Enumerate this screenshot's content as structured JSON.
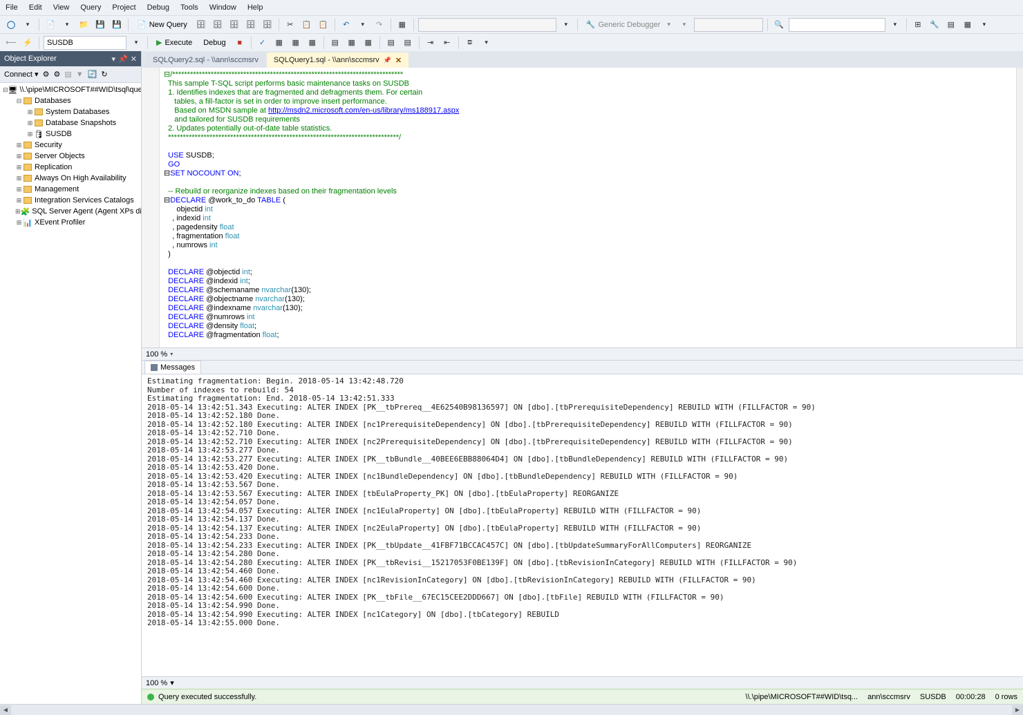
{
  "menu": [
    "File",
    "Edit",
    "View",
    "Query",
    "Project",
    "Debug",
    "Tools",
    "Window",
    "Help"
  ],
  "toolbar1": {
    "new_query": "New Query",
    "debugger_label": "Generic Debugger"
  },
  "toolbar2": {
    "db_combo": "SUSDB",
    "execute": "Execute",
    "debug": "Debug"
  },
  "object_explorer": {
    "title": "Object Explorer",
    "connect": "Connect",
    "root": "\\\\.\\pipe\\MICROSOFT##WID\\tsql\\query",
    "nodes": [
      {
        "label": "Databases",
        "depth": 1,
        "expanded": true,
        "icon": "folder"
      },
      {
        "label": "System Databases",
        "depth": 2,
        "expanded": false,
        "icon": "folder"
      },
      {
        "label": "Database Snapshots",
        "depth": 2,
        "expanded": false,
        "icon": "folder"
      },
      {
        "label": "SUSDB",
        "depth": 2,
        "expanded": false,
        "icon": "db"
      },
      {
        "label": "Security",
        "depth": 1,
        "expanded": false,
        "icon": "folder"
      },
      {
        "label": "Server Objects",
        "depth": 1,
        "expanded": false,
        "icon": "folder"
      },
      {
        "label": "Replication",
        "depth": 1,
        "expanded": false,
        "icon": "folder"
      },
      {
        "label": "Always On High Availability",
        "depth": 1,
        "expanded": false,
        "icon": "folder"
      },
      {
        "label": "Management",
        "depth": 1,
        "expanded": false,
        "icon": "folder"
      },
      {
        "label": "Integration Services Catalogs",
        "depth": 1,
        "expanded": false,
        "icon": "folder"
      },
      {
        "label": "SQL Server Agent (Agent XPs disabl",
        "depth": 1,
        "expanded": false,
        "icon": "agent"
      },
      {
        "label": "XEvent Profiler",
        "depth": 1,
        "expanded": false,
        "icon": "xe"
      }
    ]
  },
  "tabs": [
    {
      "label": "SQLQuery2.sql - \\\\ann\\sccmsrv",
      "active": false
    },
    {
      "label": "SQLQuery1.sql - \\\\ann\\sccmsrv",
      "active": true
    }
  ],
  "code_lines": [
    {
      "t": "⊟/******************************************************************************",
      "cls": "c-star"
    },
    {
      "t": "  This sample T-SQL script performs basic maintenance tasks on SUSDB",
      "cls": "c-comment"
    },
    {
      "t": "  1. Identifies indexes that are fragmented and defragments them. For certain",
      "cls": "c-comment"
    },
    {
      "t": "     tables, a fill-factor is set in order to improve insert performance.",
      "cls": "c-comment"
    },
    {
      "t": "     Based on MSDN sample at ",
      "cls": "c-comment",
      "link": "http://msdn2.microsoft.com/en-us/library/ms188917.aspx"
    },
    {
      "t": "     and tailored for SUSDB requirements",
      "cls": "c-comment"
    },
    {
      "t": "  2. Updates potentially out-of-date table statistics.",
      "cls": "c-comment"
    },
    {
      "t": "  ******************************************************************************/",
      "cls": "c-star"
    },
    {
      "t": "",
      "cls": ""
    },
    {
      "t": "  USE SUSDB;",
      "cls": "",
      "hl": [
        [
          "USE",
          "c-kw"
        ]
      ]
    },
    {
      "t": "  GO",
      "cls": "c-kw"
    },
    {
      "t": "⊟SET NOCOUNT ON;",
      "cls": "",
      "hl": [
        [
          "SET",
          "c-kw"
        ],
        [
          "NOCOUNT",
          "c-kw"
        ],
        [
          "ON",
          "c-kw"
        ]
      ]
    },
    {
      "t": "",
      "cls": ""
    },
    {
      "t": "  -- Rebuild or reorganize indexes based on their fragmentation levels",
      "cls": "c-comment"
    },
    {
      "t": "⊟DECLARE @work_to_do TABLE (",
      "cls": "",
      "hl": [
        [
          "DECLARE",
          "c-kw"
        ],
        [
          "TABLE",
          "c-kw"
        ]
      ]
    },
    {
      "t": "      objectid int",
      "cls": "",
      "hl": [
        [
          "int",
          "c-dtype"
        ]
      ]
    },
    {
      "t": "    , indexid int",
      "cls": "",
      "hl": [
        [
          "int",
          "c-dtype"
        ]
      ]
    },
    {
      "t": "    , pagedensity float",
      "cls": "",
      "hl": [
        [
          "float",
          "c-dtype"
        ]
      ]
    },
    {
      "t": "    , fragmentation float",
      "cls": "",
      "hl": [
        [
          "float",
          "c-dtype"
        ]
      ]
    },
    {
      "t": "    , numrows int",
      "cls": "",
      "hl": [
        [
          "int",
          "c-dtype"
        ]
      ]
    },
    {
      "t": "  )",
      "cls": ""
    },
    {
      "t": "",
      "cls": ""
    },
    {
      "t": "  DECLARE @objectid int;",
      "cls": "",
      "hl": [
        [
          "DECLARE",
          "c-kw"
        ],
        [
          "int",
          "c-dtype"
        ]
      ]
    },
    {
      "t": "  DECLARE @indexid int;",
      "cls": "",
      "hl": [
        [
          "DECLARE",
          "c-kw"
        ],
        [
          "int",
          "c-dtype"
        ]
      ]
    },
    {
      "t": "  DECLARE @schemaname nvarchar(130);",
      "cls": "",
      "hl": [
        [
          "DECLARE",
          "c-kw"
        ],
        [
          "nvarchar",
          "c-dtype"
        ]
      ]
    },
    {
      "t": "  DECLARE @objectname nvarchar(130);",
      "cls": "",
      "hl": [
        [
          "DECLARE",
          "c-kw"
        ],
        [
          "nvarchar",
          "c-dtype"
        ]
      ]
    },
    {
      "t": "  DECLARE @indexname nvarchar(130);",
      "cls": "",
      "hl": [
        [
          "DECLARE",
          "c-kw"
        ],
        [
          "nvarchar",
          "c-dtype"
        ]
      ]
    },
    {
      "t": "  DECLARE @numrows int",
      "cls": "",
      "hl": [
        [
          "DECLARE",
          "c-kw"
        ],
        [
          "int",
          "c-dtype"
        ]
      ]
    },
    {
      "t": "  DECLARE @density float;",
      "cls": "",
      "hl": [
        [
          "DECLARE",
          "c-kw"
        ],
        [
          "float",
          "c-dtype"
        ]
      ]
    },
    {
      "t": "  DECLARE @fragmentation float;",
      "cls": "",
      "hl": [
        [
          "DECLARE",
          "c-kw"
        ],
        [
          "float",
          "c-dtype"
        ]
      ]
    }
  ],
  "zoom": "100 %",
  "msg_tab": "Messages",
  "msg_lines": [
    "Estimating fragmentation: Begin. 2018-05-14 13:42:48.720",
    "Number of indexes to rebuild: 54",
    "Estimating fragmentation: End. 2018-05-14 13:42:51.333",
    "2018-05-14 13:42:51.343 Executing: ALTER INDEX [PK__tbPrereq__4E62540B98136597] ON [dbo].[tbPrerequisiteDependency] REBUILD WITH (FILLFACTOR = 90)",
    "2018-05-14 13:42:52.180 Done.",
    "2018-05-14 13:42:52.180 Executing: ALTER INDEX [nc1PrerequisiteDependency] ON [dbo].[tbPrerequisiteDependency] REBUILD WITH (FILLFACTOR = 90)",
    "2018-05-14 13:42:52.710 Done.",
    "2018-05-14 13:42:52.710 Executing: ALTER INDEX [nc2PrerequisiteDependency] ON [dbo].[tbPrerequisiteDependency] REBUILD WITH (FILLFACTOR = 90)",
    "2018-05-14 13:42:53.277 Done.",
    "2018-05-14 13:42:53.277 Executing: ALTER INDEX [PK__tbBundle__40BEE6EBB88064D4] ON [dbo].[tbBundleDependency] REBUILD WITH (FILLFACTOR = 90)",
    "2018-05-14 13:42:53.420 Done.",
    "2018-05-14 13:42:53.420 Executing: ALTER INDEX [nc1BundleDependency] ON [dbo].[tbBundleDependency] REBUILD WITH (FILLFACTOR = 90)",
    "2018-05-14 13:42:53.567 Done.",
    "2018-05-14 13:42:53.567 Executing: ALTER INDEX [tbEulaProperty_PK] ON [dbo].[tbEulaProperty] REORGANIZE",
    "2018-05-14 13:42:54.057 Done.",
    "2018-05-14 13:42:54.057 Executing: ALTER INDEX [nc1EulaProperty] ON [dbo].[tbEulaProperty] REBUILD WITH (FILLFACTOR = 90)",
    "2018-05-14 13:42:54.137 Done.",
    "2018-05-14 13:42:54.137 Executing: ALTER INDEX [nc2EulaProperty] ON [dbo].[tbEulaProperty] REBUILD WITH (FILLFACTOR = 90)",
    "2018-05-14 13:42:54.233 Done.",
    "2018-05-14 13:42:54.233 Executing: ALTER INDEX [PK__tbUpdate__41FBF71BCCAC457C] ON [dbo].[tbUpdateSummaryForAllComputers] REORGANIZE",
    "2018-05-14 13:42:54.280 Done.",
    "2018-05-14 13:42:54.280 Executing: ALTER INDEX [PK__tbRevisi__15217053F0BE139F] ON [dbo].[tbRevisionInCategory] REBUILD WITH (FILLFACTOR = 90)",
    "2018-05-14 13:42:54.460 Done.",
    "2018-05-14 13:42:54.460 Executing: ALTER INDEX [nc1RevisionInCategory] ON [dbo].[tbRevisionInCategory] REBUILD WITH (FILLFACTOR = 90)",
    "2018-05-14 13:42:54.600 Done.",
    "2018-05-14 13:42:54.600 Executing: ALTER INDEX [PK__tbFile__67EC15CEE2DDD667] ON [dbo].[tbFile] REBUILD WITH (FILLFACTOR = 90)",
    "2018-05-14 13:42:54.990 Done.",
    "2018-05-14 13:42:54.990 Executing: ALTER INDEX [nc1Category] ON [dbo].[tbCategory] REBUILD",
    "2018-05-14 13:42:55.000 Done."
  ],
  "status": {
    "text": "Query executed successfully.",
    "conn": "\\\\.\\pipe\\MICROSOFT##WID\\tsq...",
    "user": "ann\\sccmsrv",
    "db": "SUSDB",
    "time": "00:00:28",
    "rows": "0 rows"
  }
}
